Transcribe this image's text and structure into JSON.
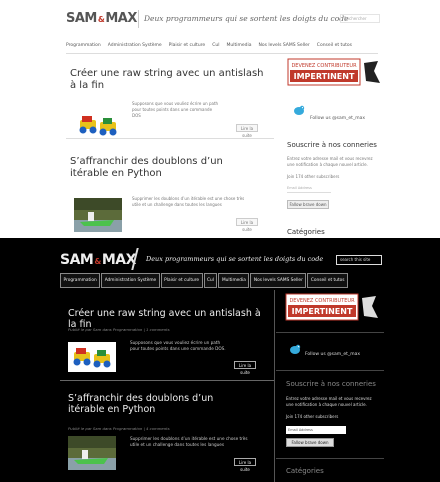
{
  "light": {
    "logo_left": "SAM",
    "logo_amp": "&",
    "logo_right": "MAX",
    "slogan": "Deux programmeurs qui se sortent les doigts du code",
    "search_placeholder": "Rechercher",
    "nav": [
      "Programmation",
      "Administration Système",
      "Plaisir et culture",
      "Cul",
      "Multimedia",
      "Nos levels SAMS Seller",
      "Conseil et tutos"
    ],
    "posts": [
      {
        "title": "Créer une raw string avec un antislash à la fin",
        "excerpt": "Supposons que vous vouliez écrire un path pour toutes points dans une commande DOS",
        "more": "Lire la suite"
      },
      {
        "title": "S’affranchir des doublons d’un itérable en Python",
        "excerpt": "Supprimer les doublons d’un itérable est une chose très utile et un challenge dans toutes les langues",
        "more": "Lire la suite"
      }
    ],
    "sidebar": {
      "badge_line1": "DEVENEZ CONTRIBUTEUR",
      "badge_line2": "IMPERTINENT",
      "follow": "Follow us @sam_et_max",
      "subscribe_title": "Souscrire à nos conneries",
      "subscribe_text": "Entrez votre adresse mail et vous recevrez une notification à chaque nouvel article.",
      "subscribers": "Join 174 other subscribers",
      "email_placeholder": "Email Address",
      "subscribe_btn": "Fallow brave down",
      "categories_title": "Catégories"
    }
  },
  "dark": {
    "logo_left": "SAM",
    "logo_amp": "&",
    "logo_right": "MAX",
    "slogan": "Deux programmeurs qui se sortent les doigts du code",
    "search_placeholder": "search this site",
    "nav": [
      "Programmation",
      "Administration Système",
      "Plaisir et culture",
      "Cul",
      "Multimedia",
      "Nos levels SAMS Seller",
      "Conseil et tutos"
    ],
    "posts": [
      {
        "title": "Créer une raw string avec un antislash à la fin",
        "meta": "Publié le par Sam dans Programmation | 1 comments",
        "excerpt": "Supposons que vous vouliez écrire un path pour toutes points dans une commande DOS.",
        "more": "Lire la suite"
      },
      {
        "title": "S’affranchir des doublons d’un itérable en Python",
        "meta": "Publié le par Sam dans Programmation | 4 comments",
        "excerpt": "Supprimer les doublons d’un itérable est une chose très utile et un challenge dans toutes les langues",
        "more": "Lire la suite"
      }
    ],
    "sidebar": {
      "badge_line1": "DEVENEZ CONTRIBUTEUR",
      "badge_line2": "IMPERTINENT",
      "follow": "Follow us @sam_et_max",
      "subscribe_title": "Souscrire à nos conneries",
      "subscribe_text": "Entrez votre adresse mail et vous recevrez une notification à chaque nouvel article.",
      "subscribers": "Join 174 other subscribers",
      "email_placeholder": "Email Address",
      "subscribe_btn": "Fallow brave down",
      "categories_title": "Catégories"
    }
  }
}
